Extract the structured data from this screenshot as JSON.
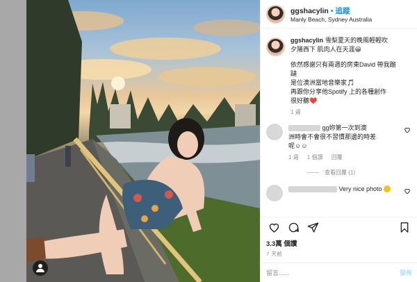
{
  "header": {
    "username": "ggshacylin",
    "follow_label": "• 追蹤",
    "location": "Manly Beach, Sydney Australia"
  },
  "caption": {
    "username": "ggshacylin",
    "line1": "雪梨夏天的晚風輕輕吹",
    "line2": "夕陽西下 肌肉人在天涯😀",
    "line3": "依然感謝只有兩週的房東David 帶我蹓",
    "line4": "躂",
    "line5": "是位澳洲當地音樂家🎵",
    "line6": "再跟你分享他Spotify 上的各種創作",
    "line7": "很好聽❤️",
    "time": "1 週"
  },
  "comment1": {
    "text_line1": "gg妳第一次到澳",
    "text_line2": "洲時會不會很不習慣那邊的時差",
    "text_line3": "呢☺☺",
    "time": "1 週",
    "likes": "1 個讚",
    "reply": "回覆",
    "view_replies": "查看回覆 (1)"
  },
  "comment2": {
    "text": "Very nice photo"
  },
  "footer": {
    "likes": "3.3萬 個讚",
    "ago": "7 天前",
    "add_placeholder": "留言......",
    "post_label": "發佈"
  },
  "colors": {
    "accent": "#0095f6",
    "text": "#262626",
    "muted": "#8e8e8e",
    "heart": "#ed4956"
  }
}
